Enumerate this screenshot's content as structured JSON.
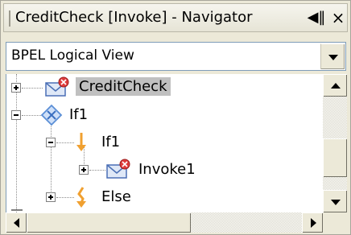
{
  "window": {
    "title": "CreditCheck [Invoke] - Navigator",
    "dock_glyph": "◀‖",
    "close_glyph": "×"
  },
  "view_selector": {
    "selected": "BPEL Logical View"
  },
  "tree": {
    "items": [
      {
        "label": "CreditCheck",
        "icon": "invoke-envelope-icon",
        "expanded": false,
        "selected": true
      },
      {
        "label": "If1",
        "icon": "if-diamond-icon",
        "expanded": true,
        "selected": false
      },
      {
        "label": "If1",
        "icon": "branch-arrow-icon",
        "expanded": true,
        "selected": false
      },
      {
        "label": "Invoke1",
        "icon": "invoke-envelope-icon",
        "expanded": false,
        "selected": false
      },
      {
        "label": "Else",
        "icon": "else-branch-icon",
        "expanded": false,
        "selected": false
      }
    ]
  },
  "colors": {
    "background": "#ece9d8",
    "selection": "#c0c0c0",
    "tree_background": "#ffffff",
    "if_diamond": "#5b8fd6",
    "branch_arrow": "#f0a030",
    "envelope_badge": "#e03c3c"
  }
}
